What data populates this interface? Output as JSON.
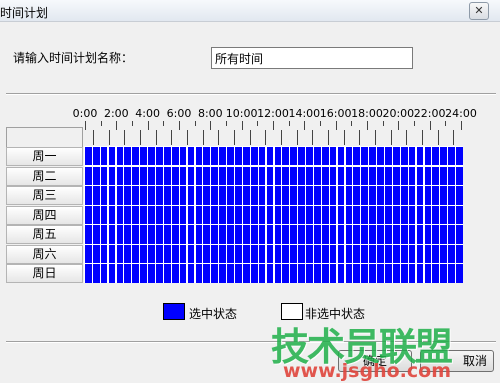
{
  "window": {
    "title": "时间计划",
    "close_label": "✕"
  },
  "form": {
    "name_label": "请输入时间计划名称：",
    "name_value": "所有时间"
  },
  "schedule": {
    "hour_labels": [
      "0:00",
      "2:00",
      "4:00",
      "6:00",
      "8:00",
      "10:00",
      "12:00",
      "14:00",
      "16:00",
      "18:00",
      "20:00",
      "22:00",
      "24:00"
    ],
    "days": [
      "周一",
      "周二",
      "周三",
      "周四",
      "周五",
      "周六",
      "周日"
    ],
    "slots_per_day": 48,
    "selected_all": true,
    "selected_color": "#0000ff",
    "unselected_color": "#ffffff"
  },
  "legend": {
    "selected_label": "选中状态",
    "unselected_label": "非选中状态"
  },
  "buttons": {
    "ok_label": "确定",
    "cancel_label": "取消"
  },
  "watermark": {
    "text": "技术员联盟",
    "url": "www.jsgho.com"
  }
}
